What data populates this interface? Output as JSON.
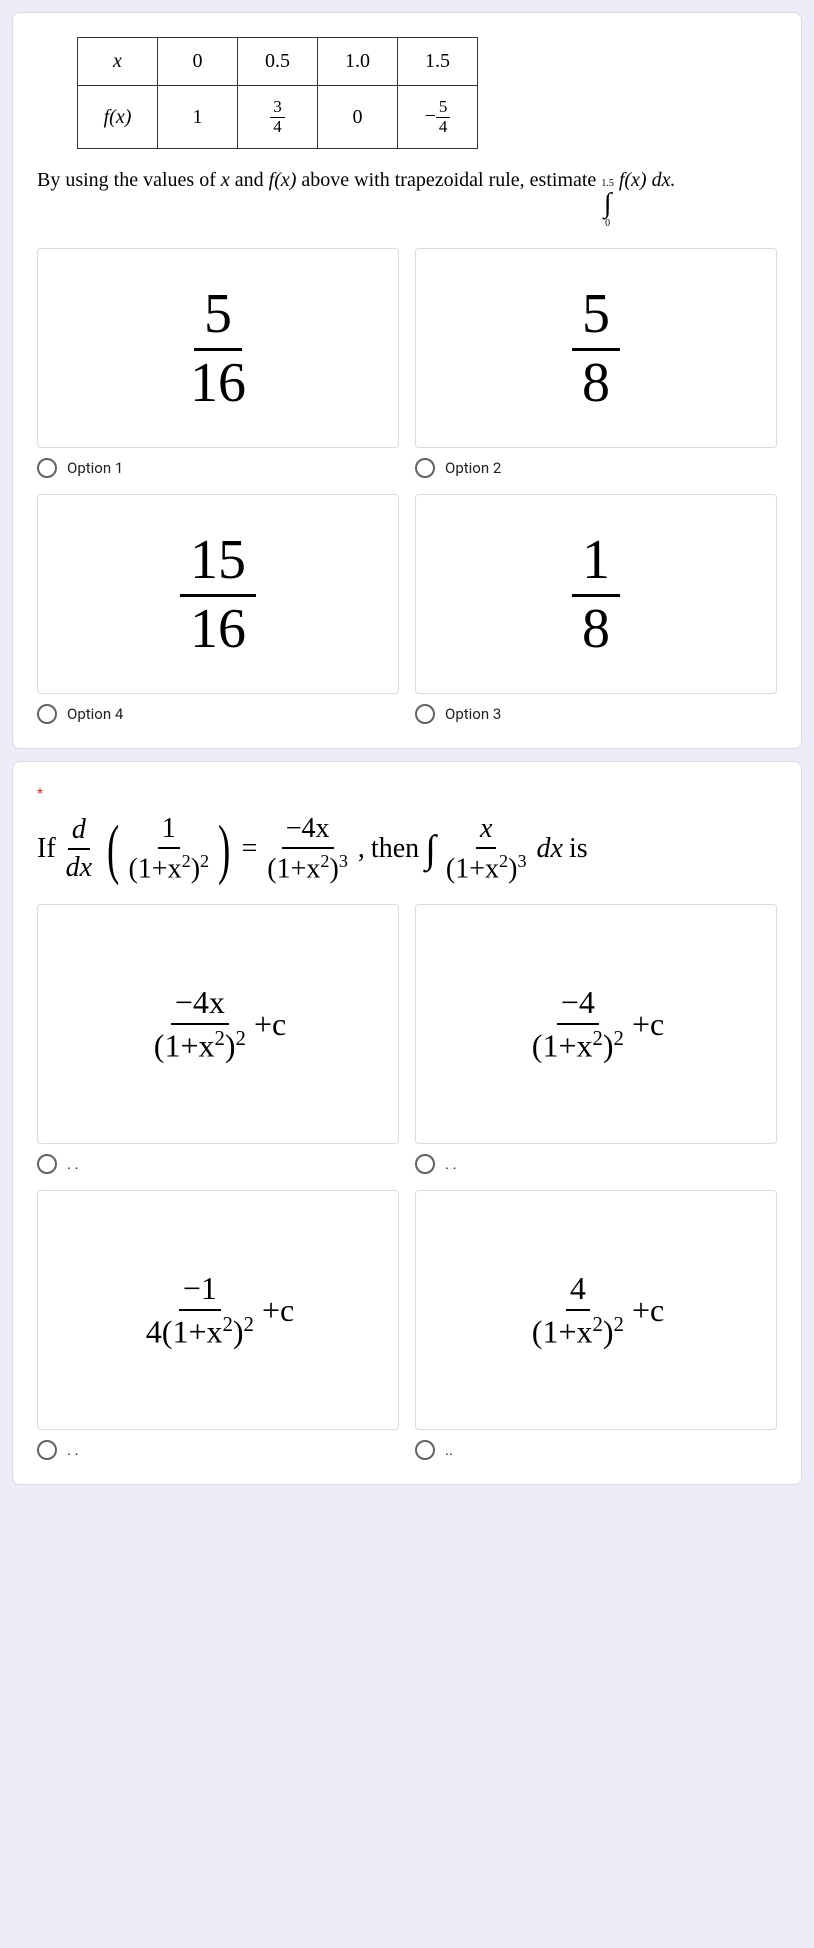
{
  "q1": {
    "table": {
      "rows": [
        {
          "h": "x",
          "c": [
            "0",
            "0.5",
            "1.0",
            "1.5"
          ]
        },
        {
          "h": "f(x)",
          "c": [
            "1",
            {
              "n": "3",
              "d": "4"
            },
            "0",
            {
              "neg": true,
              "n": "5",
              "d": "4"
            }
          ]
        }
      ]
    },
    "prompt_pre": "By using the values of ",
    "prompt_mid1": " and ",
    "prompt_mid2": " above with trapezoidal rule,  estimate ",
    "var_x": "x",
    "var_fx": "f(x)",
    "int_upper": "1.5",
    "int_lower": "0",
    "int_body": "f(x) dx.",
    "options": [
      {
        "num": "5",
        "den": "16",
        "label": "Option 1"
      },
      {
        "num": "5",
        "den": "8",
        "label": "Option 2"
      },
      {
        "num": "15",
        "den": "16",
        "label": "Option 4"
      },
      {
        "num": "1",
        "den": "8",
        "label": "Option 3"
      }
    ]
  },
  "q2": {
    "required": "*",
    "if_text": "If ",
    "d_top": "d",
    "d_bot": "dx",
    "inner_num": "1",
    "inner_den_base": "1+x",
    "inner_den_exp": "2",
    "inner_outer_exp": "2",
    "eq": "=",
    "rhs_num": "−4x",
    "rhs_den_base": "1+x",
    "rhs_den_exp": "2",
    "rhs_outer_exp": "3",
    "comma": ",",
    "then": " then ",
    "int_num": "x",
    "int_den_base": "1+x",
    "int_den_exp": "2",
    "int_outer_exp": "3",
    "dx": "dx",
    "is": " is",
    "options": [
      {
        "num": "−4x",
        "den_pre": "",
        "den_base": "1+x",
        "den_exp": "2",
        "den_outer": "2",
        "plusc": "+c",
        "label": ". ."
      },
      {
        "num": "−4",
        "den_pre": "",
        "den_base": "1+x",
        "den_exp": "2",
        "den_outer": "2",
        "plusc": "+c",
        "label": ". ."
      },
      {
        "num": "−1",
        "den_pre": "4",
        "den_base": "1+x",
        "den_exp": "2",
        "den_outer": "2",
        "plusc": "+c",
        "label": ". ."
      },
      {
        "num": "4",
        "den_pre": "",
        "den_base": "1+x",
        "den_exp": "2",
        "den_outer": "2",
        "plusc": "+c",
        "label": ".."
      }
    ]
  }
}
